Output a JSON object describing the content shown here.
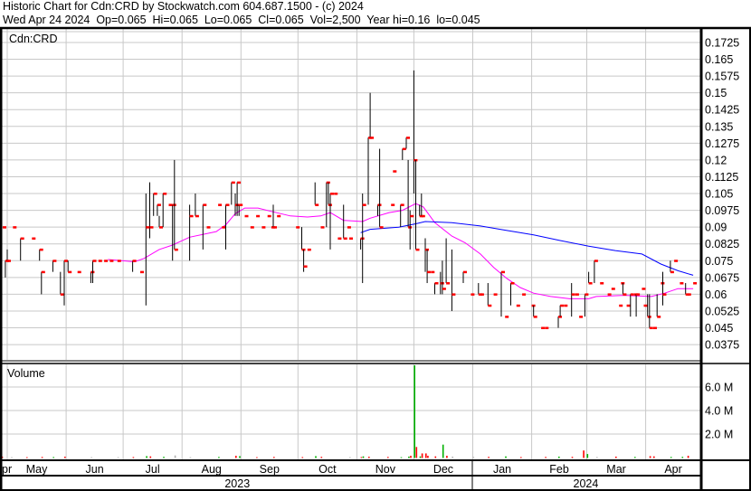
{
  "header": {
    "title": "Historic Chart for Cdn:CRD by Stockwatch.com 604.687.1500 - (c) 2024",
    "quote": "Wed Apr 24 2024  Op=0.065  Hi=0.065  Lo=0.065  Cl=0.065  Vol=2,500  Year hi=0.16  lo=0.045"
  },
  "chart_data": {
    "type": "ohlc",
    "title": "Historic Chart for Cdn:CRD",
    "symbol_label": "Cdn:CRD",
    "volume_label": "Volume",
    "base_date": "2023-05-01",
    "price_ticks": [
      "0.1725",
      "0.165",
      "0.1575",
      "0.15",
      "0.1425",
      "0.135",
      "0.1275",
      "0.12",
      "0.1125",
      "0.105",
      "0.0975",
      "0.09",
      "0.0825",
      "0.075",
      "0.0675",
      "0.06",
      "0.0525",
      "0.045",
      "0.0375"
    ],
    "volume_ticks": [
      {
        "v": 6,
        "label": "6.0 M"
      },
      {
        "v": 4,
        "label": "4.0 M"
      },
      {
        "v": 2,
        "label": "2.0 M"
      }
    ],
    "months": [
      {
        "label": "pr",
        "start": -4,
        "end": 0
      },
      {
        "label": "May",
        "start": 0,
        "end": 31
      },
      {
        "label": "Jun",
        "start": 31,
        "end": 61
      },
      {
        "label": "Jul",
        "start": 61,
        "end": 92
      },
      {
        "label": "Aug",
        "start": 92,
        "end": 123
      },
      {
        "label": "Sep",
        "start": 123,
        "end": 153
      },
      {
        "label": "Oct",
        "start": 153,
        "end": 184
      },
      {
        "label": "Nov",
        "start": 184,
        "end": 214
      },
      {
        "label": "Dec",
        "start": 214,
        "end": 245
      },
      {
        "label": "Jan",
        "start": 245,
        "end": 276
      },
      {
        "label": "Feb",
        "start": 276,
        "end": 305
      },
      {
        "label": "Mar",
        "start": 305,
        "end": 336
      },
      {
        "label": "Apr",
        "start": 336,
        "end": 365
      }
    ],
    "years": [
      {
        "label": "2023",
        "start": -4,
        "end": 245
      },
      {
        "label": "2024",
        "start": 245,
        "end": 364
      }
    ],
    "bars_format": "[day_offset, high, low, close]",
    "bars": [
      [
        -3,
        0.09,
        0.09,
        0.09
      ],
      [
        -1,
        0.075,
        0.0675,
        0.075
      ],
      [
        0,
        0.08,
        0.075,
        0.075
      ],
      [
        3,
        0.09,
        0.09,
        0.09
      ],
      [
        7,
        0.085,
        0.075,
        0.085
      ],
      [
        13,
        0.085,
        0.085,
        0.085
      ],
      [
        17,
        0.08,
        0.075,
        0.08
      ],
      [
        18,
        0.07,
        0.06,
        0.07
      ],
      [
        24,
        0.075,
        0.07,
        0.075
      ],
      [
        28,
        0.07,
        0.06,
        0.06
      ],
      [
        30,
        0.075,
        0.055,
        0.075
      ],
      [
        32,
        0.075,
        0.07,
        0.07
      ],
      [
        37,
        0.07,
        0.07,
        0.07
      ],
      [
        44,
        0.07,
        0.065,
        0.07
      ],
      [
        45,
        0.075,
        0.065,
        0.075
      ],
      [
        48,
        0.075,
        0.075,
        0.075
      ],
      [
        51,
        0.075,
        0.075,
        0.075
      ],
      [
        54,
        0.075,
        0.075,
        0.075
      ],
      [
        58,
        0.075,
        0.075,
        0.075
      ],
      [
        66,
        0.075,
        0.07,
        0.075
      ],
      [
        70,
        0.07,
        0.07,
        0.07
      ],
      [
        73,
        0.105,
        0.055,
        0.09
      ],
      [
        75,
        0.11,
        0.085,
        0.09
      ],
      [
        77,
        0.105,
        0.095,
        0.105
      ],
      [
        79,
        0.1,
        0.095,
        0.1
      ],
      [
        80,
        0.095,
        0.09,
        0.09
      ],
      [
        82,
        0.105,
        0.09,
        0.105
      ],
      [
        85,
        0.1,
        0.1,
        0.1
      ],
      [
        87,
        0.1,
        0.075,
        0.1
      ],
      [
        88,
        0.12,
        0.08,
        0.08
      ],
      [
        96,
        0.1,
        0.075,
        0.095
      ],
      [
        99,
        0.105,
        0.095,
        0.095
      ],
      [
        103,
        0.1,
        0.08,
        0.1
      ],
      [
        105,
        0.09,
        0.09,
        0.09
      ],
      [
        111,
        0.1,
        0.1,
        0.1
      ],
      [
        113,
        0.09,
        0.09,
        0.09
      ],
      [
        115,
        0.1,
        0.08,
        0.1
      ],
      [
        118,
        0.11,
        0.1,
        0.11
      ],
      [
        120,
        0.105,
        0.095,
        0.1
      ],
      [
        121,
        0.11,
        0.095,
        0.11
      ],
      [
        122,
        0.1,
        0.095,
        0.1
      ],
      [
        125,
        0.095,
        0.095,
        0.095
      ],
      [
        128,
        0.09,
        0.09,
        0.09
      ],
      [
        131,
        0.095,
        0.095,
        0.095
      ],
      [
        134,
        0.09,
        0.09,
        0.09
      ],
      [
        137,
        0.095,
        0.095,
        0.095
      ],
      [
        139,
        0.09,
        0.09,
        0.09
      ],
      [
        140,
        0.1,
        0.09,
        0.09
      ],
      [
        142,
        0.095,
        0.095,
        0.095
      ],
      [
        152,
        0.09,
        0.09,
        0.09
      ],
      [
        155,
        0.09,
        0.08,
        0.08
      ],
      [
        156,
        0.08,
        0.07,
        0.0725
      ],
      [
        158,
        0.08,
        0.08,
        0.08
      ],
      [
        162,
        0.11,
        0.1,
        0.1
      ],
      [
        165,
        0.09,
        0.09,
        0.09
      ],
      [
        168,
        0.11,
        0.09,
        0.11
      ],
      [
        169,
        0.11,
        0.1,
        0.1
      ],
      [
        170,
        0.105,
        0.08,
        0.105
      ],
      [
        172,
        0.105,
        0.105,
        0.105
      ],
      [
        174,
        0.085,
        0.085,
        0.085
      ],
      [
        177,
        0.1,
        0.085,
        0.085
      ],
      [
        179,
        0.09,
        0.09,
        0.09
      ],
      [
        180,
        0.085,
        0.085,
        0.085
      ],
      [
        186,
        0.085,
        0.08,
        0.085
      ],
      [
        187,
        0.105,
        0.065,
        0.1
      ],
      [
        190,
        0.13,
        0.1,
        0.13
      ],
      [
        191,
        0.15,
        0.13,
        0.13
      ],
      [
        195,
        0.1,
        0.095,
        0.1
      ],
      [
        196,
        0.125,
        0.09,
        0.09
      ],
      [
        202,
        0.1,
        0.1,
        0.1
      ],
      [
        203,
        0.115,
        0.115,
        0.115
      ],
      [
        207,
        0.1,
        0.09,
        0.1
      ],
      [
        208,
        0.125,
        0.12,
        0.125
      ],
      [
        210,
        0.13,
        0.125,
        0.13
      ],
      [
        211,
        0.12,
        0.09,
        0.09
      ],
      [
        212,
        0.0975,
        0.08,
        0.095
      ],
      [
        214,
        0.16,
        0.105,
        0.12
      ],
      [
        215,
        0.12,
        0.08,
        0.08
      ],
      [
        217,
        0.1,
        0.095,
        0.095
      ],
      [
        218,
        0.105,
        0.095,
        0.095
      ],
      [
        220,
        0.085,
        0.07,
        0.08
      ],
      [
        221,
        0.08,
        0.065,
        0.07
      ],
      [
        223,
        0.07,
        0.07,
        0.07
      ],
      [
        225,
        0.065,
        0.06,
        0.065
      ],
      [
        228,
        0.07,
        0.06,
        0.065
      ],
      [
        229,
        0.075,
        0.06,
        0.0625
      ],
      [
        231,
        0.085,
        0.065,
        0.065
      ],
      [
        234,
        0.08,
        0.0525,
        0.06
      ],
      [
        240,
        0.07,
        0.065,
        0.07
      ],
      [
        244,
        0.06,
        0.06,
        0.06
      ],
      [
        248,
        0.065,
        0.06,
        0.06
      ],
      [
        249,
        0.06,
        0.06,
        0.06
      ],
      [
        253,
        0.065,
        0.055,
        0.055
      ],
      [
        256,
        0.06,
        0.06,
        0.06
      ],
      [
        260,
        0.07,
        0.05,
        0.07
      ],
      [
        262,
        0.05,
        0.05,
        0.05
      ],
      [
        265,
        0.065,
        0.055,
        0.065
      ],
      [
        268,
        0.055,
        0.055,
        0.055
      ],
      [
        271,
        0.06,
        0.06,
        0.06
      ],
      [
        276,
        0.055,
        0.055,
        0.055
      ],
      [
        277,
        0.055,
        0.05,
        0.05
      ],
      [
        281,
        0.045,
        0.045,
        0.045
      ],
      [
        283,
        0.045,
        0.045,
        0.045
      ],
      [
        290,
        0.05,
        0.045,
        0.05
      ],
      [
        291,
        0.055,
        0.05,
        0.055
      ],
      [
        293,
        0.055,
        0.055,
        0.055
      ],
      [
        297,
        0.065,
        0.05,
        0.06
      ],
      [
        299,
        0.06,
        0.06,
        0.06
      ],
      [
        301,
        0.05,
        0.05,
        0.05
      ],
      [
        304,
        0.06,
        0.05,
        0.06
      ],
      [
        306,
        0.07,
        0.065,
        0.065
      ],
      [
        309,
        0.075,
        0.065,
        0.075
      ],
      [
        312,
        0.065,
        0.065,
        0.065
      ],
      [
        316,
        0.06,
        0.06,
        0.06
      ],
      [
        318,
        0.0625,
        0.0625,
        0.0625
      ],
      [
        322,
        0.055,
        0.055,
        0.055
      ],
      [
        323,
        0.065,
        0.065,
        0.065
      ],
      [
        324,
        0.065,
        0.06,
        0.06
      ],
      [
        326,
        0.055,
        0.055,
        0.055
      ],
      [
        328,
        0.06,
        0.05,
        0.06
      ],
      [
        330,
        0.06,
        0.06,
        0.06
      ],
      [
        331,
        0.06,
        0.05,
        0.06
      ],
      [
        334,
        0.0625,
        0.0625,
        0.0625
      ],
      [
        335,
        0.055,
        0.055,
        0.055
      ],
      [
        337,
        0.06,
        0.05,
        0.05
      ],
      [
        338,
        0.06,
        0.045,
        0.045
      ],
      [
        340,
        0.045,
        0.045,
        0.045
      ],
      [
        342,
        0.06,
        0.05,
        0.05
      ],
      [
        344,
        0.065,
        0.065,
        0.065
      ],
      [
        345,
        0.07,
        0.055,
        0.06
      ],
      [
        349,
        0.075,
        0.07,
        0.07
      ],
      [
        351,
        0.075,
        0.075,
        0.075
      ],
      [
        354,
        0.065,
        0.065,
        0.065
      ],
      [
        357,
        0.065,
        0.06,
        0.06
      ],
      [
        358,
        0.06,
        0.06,
        0.06
      ],
      [
        361,
        0.065,
        0.065,
        0.065
      ]
    ],
    "ma_short": [
      [
        53,
        0.0755
      ],
      [
        67,
        0.0745
      ],
      [
        72,
        0.076
      ],
      [
        80,
        0.08
      ],
      [
        87,
        0.082
      ],
      [
        96,
        0.0855
      ],
      [
        110,
        0.088
      ],
      [
        115,
        0.091
      ],
      [
        120,
        0.096
      ],
      [
        125,
        0.0985
      ],
      [
        132,
        0.0985
      ],
      [
        139,
        0.097
      ],
      [
        149,
        0.095
      ],
      [
        158,
        0.0945
      ],
      [
        165,
        0.095
      ],
      [
        170,
        0.0965
      ],
      [
        177,
        0.093
      ],
      [
        187,
        0.0925
      ],
      [
        191,
        0.094
      ],
      [
        201,
        0.0965
      ],
      [
        208,
        0.0975
      ],
      [
        215,
        0.1005
      ],
      [
        219,
        0.099
      ],
      [
        225,
        0.092
      ],
      [
        234,
        0.086
      ],
      [
        241,
        0.083
      ],
      [
        249,
        0.078
      ],
      [
        256,
        0.072
      ],
      [
        263,
        0.067
      ],
      [
        270,
        0.063
      ],
      [
        277,
        0.0605
      ],
      [
        286,
        0.059
      ],
      [
        296,
        0.058
      ],
      [
        306,
        0.058
      ],
      [
        310,
        0.059
      ],
      [
        325,
        0.0595
      ],
      [
        339,
        0.059
      ],
      [
        346,
        0.0605
      ],
      [
        353,
        0.0625
      ],
      [
        361,
        0.0625
      ]
    ],
    "ma_long": [
      [
        186,
        0.0875
      ],
      [
        191,
        0.089
      ],
      [
        206,
        0.09
      ],
      [
        215,
        0.0915
      ],
      [
        220,
        0.0925
      ],
      [
        234,
        0.092
      ],
      [
        249,
        0.0905
      ],
      [
        263,
        0.0885
      ],
      [
        277,
        0.0865
      ],
      [
        291,
        0.084
      ],
      [
        306,
        0.0815
      ],
      [
        320,
        0.0795
      ],
      [
        334,
        0.078
      ],
      [
        344,
        0.0735
      ],
      [
        353,
        0.0705
      ],
      [
        361,
        0.0685
      ]
    ],
    "volume_format": "[day_offset, millions, direction]",
    "volume": [
      [
        -3,
        0.08,
        "down"
      ],
      [
        2,
        0.03,
        "flat"
      ],
      [
        10,
        0.03,
        "down"
      ],
      [
        18,
        0.05,
        "down"
      ],
      [
        24,
        0.04,
        "up"
      ],
      [
        30,
        0.07,
        "down"
      ],
      [
        44,
        0.03,
        "flat"
      ],
      [
        58,
        0.03,
        "flat"
      ],
      [
        66,
        0.04,
        "down"
      ],
      [
        73,
        0.12,
        "up"
      ],
      [
        75,
        0.1,
        "down"
      ],
      [
        82,
        0.06,
        "up"
      ],
      [
        88,
        0.18,
        "flat"
      ],
      [
        96,
        0.03,
        "flat"
      ],
      [
        111,
        0.05,
        "up"
      ],
      [
        120,
        0.15,
        "down"
      ],
      [
        122,
        0.12,
        "up"
      ],
      [
        131,
        0.03,
        "down"
      ],
      [
        140,
        0.05,
        "down"
      ],
      [
        155,
        0.04,
        "down"
      ],
      [
        162,
        0.12,
        "up"
      ],
      [
        165,
        0.06,
        "down"
      ],
      [
        180,
        0.03,
        "flat"
      ],
      [
        186,
        0.04,
        "down"
      ],
      [
        187,
        0.1,
        "up"
      ],
      [
        190,
        0.07,
        "down"
      ],
      [
        200,
        0.05,
        "down"
      ],
      [
        207,
        0.03,
        "up"
      ],
      [
        211,
        0.08,
        "up"
      ],
      [
        212,
        0.15,
        "down"
      ],
      [
        214,
        8.0,
        "up"
      ],
      [
        215,
        0.9,
        "down"
      ],
      [
        217,
        0.1,
        "up"
      ],
      [
        218,
        0.35,
        "down"
      ],
      [
        220,
        0.35,
        "down"
      ],
      [
        221,
        0.15,
        "down"
      ],
      [
        225,
        0.1,
        "down"
      ],
      [
        229,
        1.1,
        "up"
      ],
      [
        231,
        0.15,
        "down"
      ],
      [
        234,
        0.08,
        "flat"
      ],
      [
        245,
        0.05,
        "flat"
      ],
      [
        253,
        0.06,
        "down"
      ],
      [
        262,
        0.1,
        "up"
      ],
      [
        270,
        0.04,
        "down"
      ],
      [
        283,
        0.05,
        "down"
      ],
      [
        290,
        0.08,
        "up"
      ],
      [
        297,
        0.06,
        "down"
      ],
      [
        303,
        0.6,
        "down"
      ],
      [
        305,
        0.3,
        "up"
      ],
      [
        310,
        0.04,
        "flat"
      ],
      [
        320,
        0.08,
        "down"
      ],
      [
        330,
        0.05,
        "up"
      ],
      [
        338,
        0.12,
        "down"
      ],
      [
        340,
        0.1,
        "down"
      ],
      [
        349,
        0.05,
        "up"
      ],
      [
        355,
        0.06,
        "up"
      ],
      [
        358,
        0.15,
        "down"
      ]
    ],
    "colors": {
      "up": "#00b000",
      "down": "#ff0000",
      "flat": "#b0b0b0",
      "bar": "#000000",
      "close_tick": "#ff0000",
      "ma_short": "#ff00ff",
      "ma_long": "#0000ff",
      "grid": "#c8c8c8"
    }
  }
}
